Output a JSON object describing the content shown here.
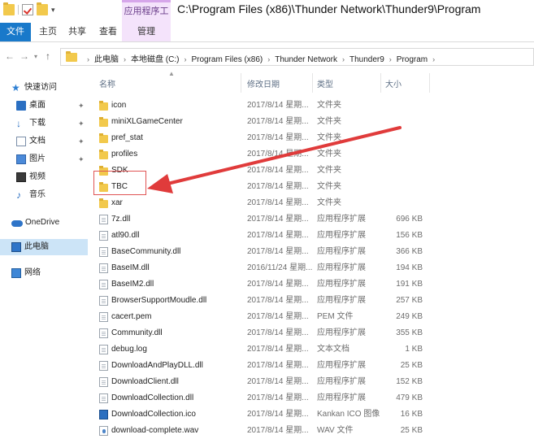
{
  "window": {
    "title_path": "C:\\Program Files (x86)\\Thunder Network\\Thunder9\\Program",
    "context_tab_group": "应用程序工具"
  },
  "ribbon": {
    "tabs": [
      {
        "label": "文件"
      },
      {
        "label": "主页"
      },
      {
        "label": "共享"
      },
      {
        "label": "查看"
      },
      {
        "label": "管理"
      }
    ]
  },
  "address": {
    "crumbs": [
      "此电脑",
      "本地磁盘 (C:)",
      "Program Files (x86)",
      "Thunder Network",
      "Thunder9",
      "Program"
    ]
  },
  "sidebar": {
    "items": [
      {
        "label": "快速访问",
        "icon": "star-icon"
      },
      {
        "label": "桌面",
        "icon": "desktop-icon",
        "pinned": true
      },
      {
        "label": "下载",
        "icon": "download-icon",
        "pinned": true
      },
      {
        "label": "文档",
        "icon": "document-icon",
        "pinned": true
      },
      {
        "label": "图片",
        "icon": "picture-icon",
        "pinned": true
      },
      {
        "label": "视频",
        "icon": "video-icon"
      },
      {
        "label": "音乐",
        "icon": "music-icon"
      },
      {
        "label": "OneDrive",
        "icon": "cloud-icon"
      },
      {
        "label": "此电脑",
        "icon": "computer-icon",
        "selected": true
      },
      {
        "label": "网络",
        "icon": "network-icon"
      }
    ],
    "pin_glyph": "✦"
  },
  "columns": {
    "name": "名称",
    "date": "修改日期",
    "type": "类型",
    "size": "大小"
  },
  "files": [
    {
      "name": "icon",
      "date": "2017/8/14 星期...",
      "type": "文件夹",
      "size": "",
      "kind": "folder"
    },
    {
      "name": "miniXLGameCenter",
      "date": "2017/8/14 星期...",
      "type": "文件夹",
      "size": "",
      "kind": "folder"
    },
    {
      "name": "pref_stat",
      "date": "2017/8/14 星期...",
      "type": "文件夹",
      "size": "",
      "kind": "folder"
    },
    {
      "name": "profiles",
      "date": "2017/8/14 星期...",
      "type": "文件夹",
      "size": "",
      "kind": "folder"
    },
    {
      "name": "SDK",
      "date": "2017/8/14 星期...",
      "type": "文件夹",
      "size": "",
      "kind": "folder"
    },
    {
      "name": "TBC",
      "date": "2017/8/14 星期...",
      "type": "文件夹",
      "size": "",
      "kind": "folder"
    },
    {
      "name": "xar",
      "date": "2017/8/14 星期...",
      "type": "文件夹",
      "size": "",
      "kind": "folder"
    },
    {
      "name": "7z.dll",
      "date": "2017/8/14 星期...",
      "type": "应用程序扩展",
      "size": "696 KB",
      "kind": "file"
    },
    {
      "name": "atl90.dll",
      "date": "2017/8/14 星期...",
      "type": "应用程序扩展",
      "size": "156 KB",
      "kind": "file"
    },
    {
      "name": "BaseCommunity.dll",
      "date": "2017/8/14 星期...",
      "type": "应用程序扩展",
      "size": "366 KB",
      "kind": "file"
    },
    {
      "name": "BaseIM.dll",
      "date": "2016/11/24 星期...",
      "type": "应用程序扩展",
      "size": "194 KB",
      "kind": "file"
    },
    {
      "name": "BaseIM2.dll",
      "date": "2017/8/14 星期...",
      "type": "应用程序扩展",
      "size": "191 KB",
      "kind": "file"
    },
    {
      "name": "BrowserSupportMoudle.dll",
      "date": "2017/8/14 星期...",
      "type": "应用程序扩展",
      "size": "257 KB",
      "kind": "file"
    },
    {
      "name": "cacert.pem",
      "date": "2017/8/14 星期...",
      "type": "PEM 文件",
      "size": "249 KB",
      "kind": "file"
    },
    {
      "name": "Community.dll",
      "date": "2017/8/14 星期...",
      "type": "应用程序扩展",
      "size": "355 KB",
      "kind": "file"
    },
    {
      "name": "debug.log",
      "date": "2017/8/14 星期...",
      "type": "文本文档",
      "size": "1 KB",
      "kind": "file"
    },
    {
      "name": "DownloadAndPlayDLL.dll",
      "date": "2017/8/14 星期...",
      "type": "应用程序扩展",
      "size": "25 KB",
      "kind": "file"
    },
    {
      "name": "DownloadClient.dll",
      "date": "2017/8/14 星期...",
      "type": "应用程序扩展",
      "size": "152 KB",
      "kind": "file"
    },
    {
      "name": "DownloadCollection.dll",
      "date": "2017/8/14 星期...",
      "type": "应用程序扩展",
      "size": "479 KB",
      "kind": "file"
    },
    {
      "name": "DownloadCollection.ico",
      "date": "2017/8/14 星期...",
      "type": "Kankan ICO 图像",
      "size": "16 KB",
      "kind": "ico"
    },
    {
      "name": "download-complete.wav",
      "date": "2017/8/14 星期...",
      "type": "WAV 文件",
      "size": "25 KB",
      "kind": "wav"
    }
  ],
  "colors": {
    "file_tab": "#1979ca",
    "context_tab": "#f4e3fb",
    "selection": "#cce4f7",
    "annotation": "#e03b3b"
  }
}
